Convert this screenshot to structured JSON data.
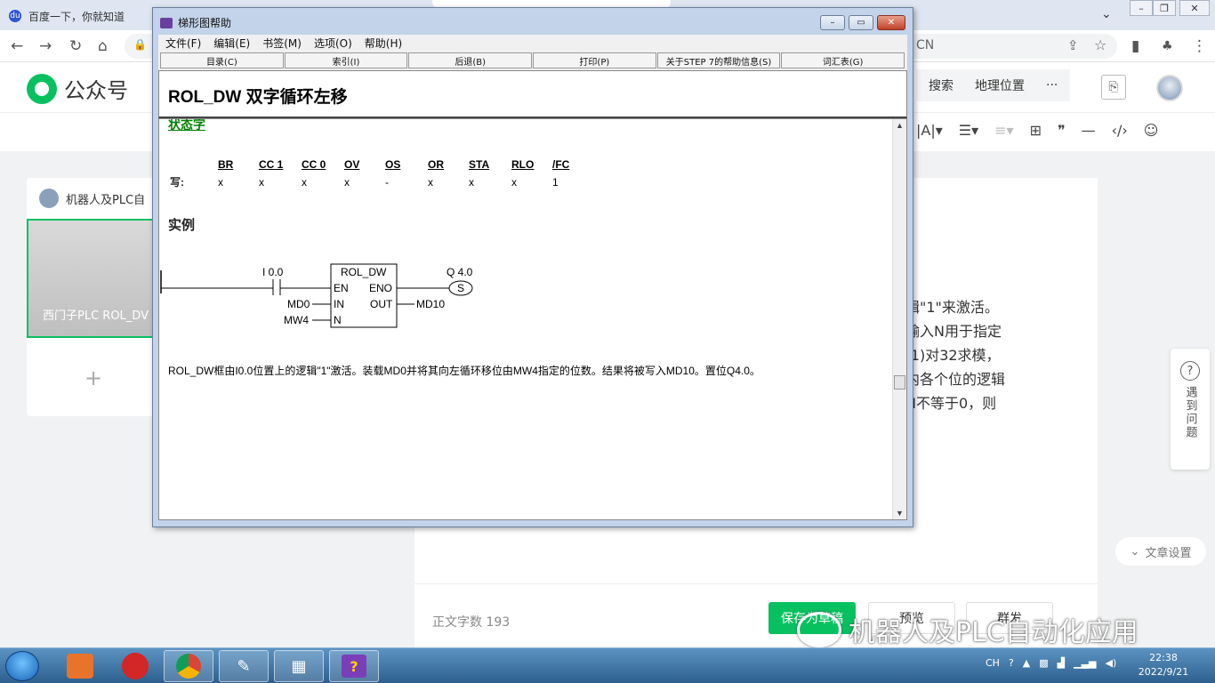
{
  "browser": {
    "tab_title": "百度一下，你就知道",
    "url_tail": "CN",
    "win_min": "–",
    "win_restore": "❐",
    "win_close": "✕"
  },
  "wechat": {
    "logo_text": "公众号",
    "header_links": [
      "搜索",
      "地理位置",
      "···"
    ],
    "left_card_account": "机器人及PLC自",
    "left_card_article": "西门子PLC ROL_DV",
    "left_card_add": "+",
    "content_lines": [
      "辑\"1\"来激活。",
      "输入N用于指定",
      "-1)对32求模，",
      "内各个位的逻辑",
      "N不等于0，则"
    ],
    "word_count": "正文字数 193",
    "save_label": "保存为草稿",
    "preview_label": "预览",
    "mass_label": "群发",
    "ask_question": "遇到问题",
    "article_settings": "文章设置",
    "watermark": "机器人及PLC自动化应用"
  },
  "help": {
    "window_title": "梯形图帮助",
    "menu": [
      "文件(F)",
      "编辑(E)",
      "书签(M)",
      "选项(O)",
      "帮助(H)"
    ],
    "buttons": [
      "目录(C)",
      "索引(I)",
      "后退(B)",
      "打印(P)",
      "关于STEP 7的帮助信息(S)",
      "词汇表(G)"
    ],
    "heading": "ROL_DW  双字循环左移",
    "status_heading": "状态字",
    "status_write_label": "写:",
    "status_bits": [
      {
        "name": "BR",
        "value": "x"
      },
      {
        "name": "CC 1",
        "value": "x"
      },
      {
        "name": "CC 0",
        "value": "x"
      },
      {
        "name": "OV",
        "value": "x"
      },
      {
        "name": "OS",
        "value": "-"
      },
      {
        "name": "OR",
        "value": "x"
      },
      {
        "name": "STA",
        "value": "x"
      },
      {
        "name": "RLO",
        "value": "x"
      },
      {
        "name": "/FC",
        "value": "1"
      }
    ],
    "example_heading": "实例",
    "ladder": {
      "contact": "I 0.0",
      "box_title": "ROL_DW",
      "en": "EN",
      "eno": "ENO",
      "in": "IN",
      "out": "OUT",
      "n": "N",
      "in_operand": "MD0",
      "n_operand": "MW4",
      "out_operand": "MD10",
      "coil": "Q 4.0",
      "coil_type": "S"
    },
    "description": "ROL_DW框由I0.0位置上的逻辑\"1\"激活。装载MD0并将其向左循环移位由MW4指定的位数。结果将被写入MD10。置位Q4.0。"
  },
  "taskbar": {
    "tray_lang": "CH",
    "time": "22:38",
    "date": "2022/9/21"
  }
}
